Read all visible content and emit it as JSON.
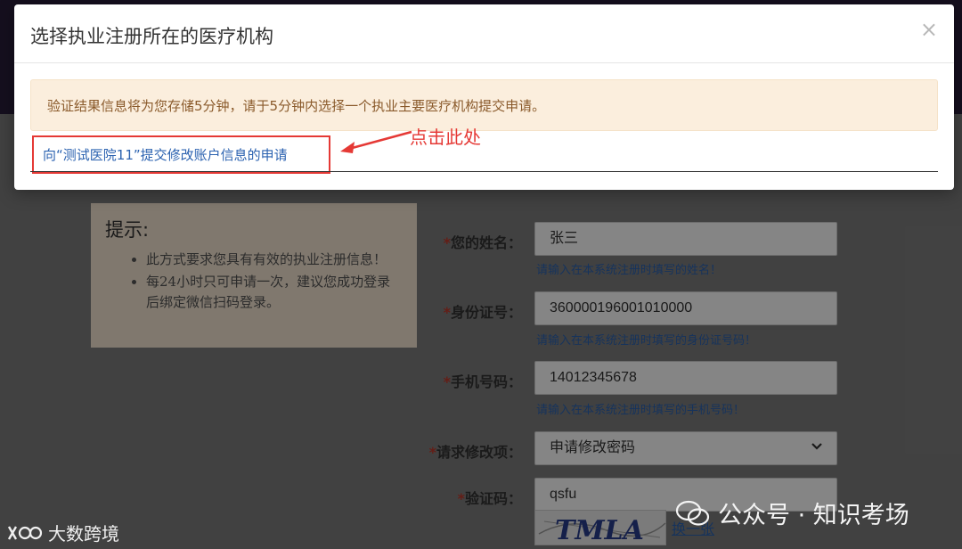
{
  "modal": {
    "title": "选择执业注册所在的医疗机构",
    "close_icon": "×",
    "alert_text": "验证结果信息将为您存储5分钟，请于5分钟内选择一个执业主要医疗机构提交申请。",
    "apply_link": "向“测试医院11”提交修改账户信息的申请",
    "annotation": "点击此处"
  },
  "tips": {
    "title": "提示:",
    "items": [
      "此方式要求您具有有效的执业注册信息！",
      "每24小时只可申请一次，建议您成功登录后绑定微信扫码登录。"
    ]
  },
  "form": {
    "name": {
      "label": "您的姓名：",
      "value": "张三",
      "hint": "请输入在本系统注册时填写的姓名！"
    },
    "id_number": {
      "label": "身份证号：",
      "value": "360000196001010000",
      "hint": "请输入在本系统注册时填写的身份证号码！"
    },
    "phone": {
      "label": "手机号码：",
      "value": "14012345678",
      "hint": "请输入在本系统注册时填写的手机号码！"
    },
    "change_item": {
      "label": "请求修改项：",
      "value": "申请修改密码"
    },
    "captcha": {
      "label": "验证码：",
      "value": "qsfu",
      "image_text": "TMLA",
      "refresh": "换一张"
    }
  },
  "watermarks": {
    "left": "大数跨境",
    "right": "公众号 · 知识考场"
  },
  "colors": {
    "link": "#2b62b0",
    "annotation_red": "#e53935",
    "alert_bg": "#fbeedd",
    "topbar": "#2a1e3a"
  }
}
